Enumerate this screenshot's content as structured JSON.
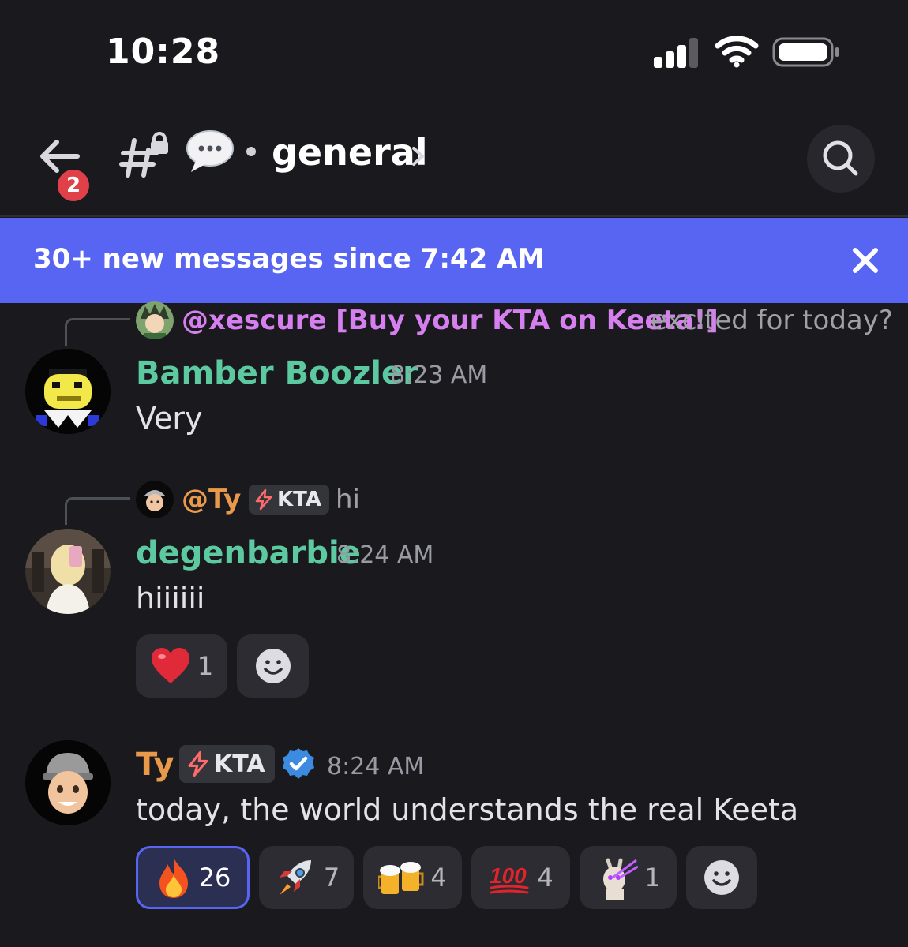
{
  "status_bar": {
    "time": "10:28"
  },
  "header": {
    "unread_count": "2",
    "channel_name": "general"
  },
  "banner": {
    "text": "30+ new messages since 7:42 AM"
  },
  "messages": [
    {
      "reply": {
        "mention": "@xescure [Buy your KTA on Keeta!]",
        "text": "excited for today?",
        "mention_color": "#d680f0"
      },
      "username": "Bamber Boozler",
      "username_color": "#5cc9a0",
      "timestamp": "8:23 AM",
      "text": "Very"
    },
    {
      "reply": {
        "mention": "@Ty",
        "role_tag": "KTA",
        "text": "hi",
        "mention_color": "#e89a4a"
      },
      "username": "degenbarbie",
      "username_color": "#5cc9a0",
      "timestamp": "8:24 AM",
      "text": "hiiiiii",
      "reactions": [
        {
          "emoji": "heart",
          "count": "1"
        }
      ]
    },
    {
      "username": "Ty",
      "username_color": "#e89a4a",
      "role_tag": "KTA",
      "verified": true,
      "timestamp": "8:24 AM",
      "text": "today, the world understands the real Keeta",
      "reactions": [
        {
          "emoji": "fire",
          "count": "26",
          "active": true
        },
        {
          "emoji": "rocket",
          "count": "7"
        },
        {
          "emoji": "beer-mugs",
          "count": "4"
        },
        {
          "emoji": "hundred",
          "count": "4"
        },
        {
          "emoji": "laser-llama",
          "count": "1"
        }
      ]
    }
  ],
  "colors": {
    "background": "#1a1a1e",
    "banner": "#5865f2",
    "badge": "#e04048",
    "timestamp": "#9a9aa4"
  }
}
